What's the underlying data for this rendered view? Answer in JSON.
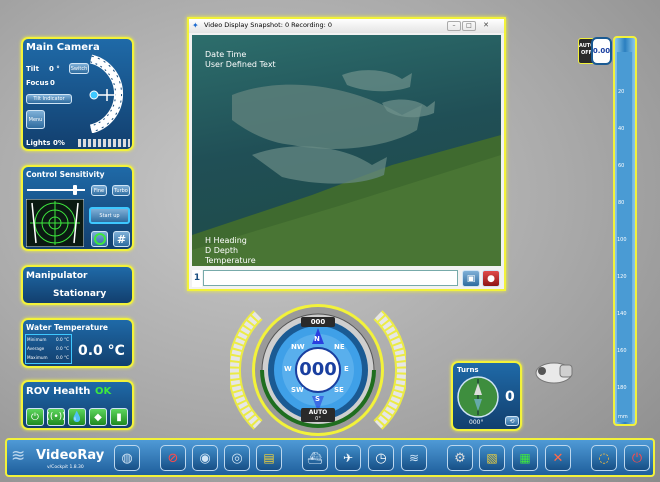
{
  "main_camera": {
    "title": "Main Camera",
    "tilt_label": "Tilt",
    "tilt_value": "0 °",
    "switch_label": "Switch",
    "focus_label": "Focus",
    "focus_value": "0",
    "tilt_indicator_label": "Tilt Indicator",
    "menu_label": "Menu",
    "lights_label": "Lights",
    "lights_value": "0%"
  },
  "control_sensitivity": {
    "title": "Control Sensitivity",
    "fine_label": "Fine",
    "turbo_label": "Turbo",
    "start_up_label": "Start up",
    "hash_label": "#"
  },
  "manipulator": {
    "title": "Manipulator",
    "status": "Stationary"
  },
  "water_temperature": {
    "title": "Water Temperature",
    "rows": [
      {
        "label": "Minimum",
        "value": "0.0 °C"
      },
      {
        "label": "Average",
        "value": "0.0 °C"
      },
      {
        "label": "Maximum",
        "value": "0.0 °C"
      }
    ],
    "current": "0.0 °C"
  },
  "rov_health": {
    "title": "ROV Health",
    "status": "OK"
  },
  "video": {
    "window_title": "Video Display Snapshot: 0 Recording: 0",
    "overlay_top_1": "Date Time",
    "overlay_top_2": "User Defined Text",
    "overlay_bottom_1": "H Heading",
    "overlay_bottom_2": "D Depth",
    "overlay_bottom_3": "Temperature",
    "channel_number": "1"
  },
  "compass": {
    "heading": "000",
    "top_label": "000",
    "auto_label": "AUTO",
    "auto_value": "0°",
    "cardinals": {
      "n": "N",
      "ne": "NE",
      "e": "E",
      "se": "SE",
      "s": "S",
      "sw": "SW",
      "w": "W",
      "nw": "NW"
    }
  },
  "turns": {
    "title": "Turns",
    "value": "0",
    "heading": "000°"
  },
  "depth_gauge": {
    "auto_label": "AUTO",
    "off_label": "OFF",
    "value": "0.00",
    "ticks": [
      "20",
      "40",
      "60",
      "80",
      "100",
      "120",
      "140",
      "160",
      "180"
    ],
    "unit": "mm"
  },
  "toolbar": {
    "brand": "VideoRay",
    "version": "v/Cockpit 1.8.30"
  },
  "colors": {
    "panel_border": "#f2f23a",
    "panel_bg": "#1a5a93",
    "ok_green": "#3ee83e",
    "toolbar_bg": "#2a78c2"
  }
}
